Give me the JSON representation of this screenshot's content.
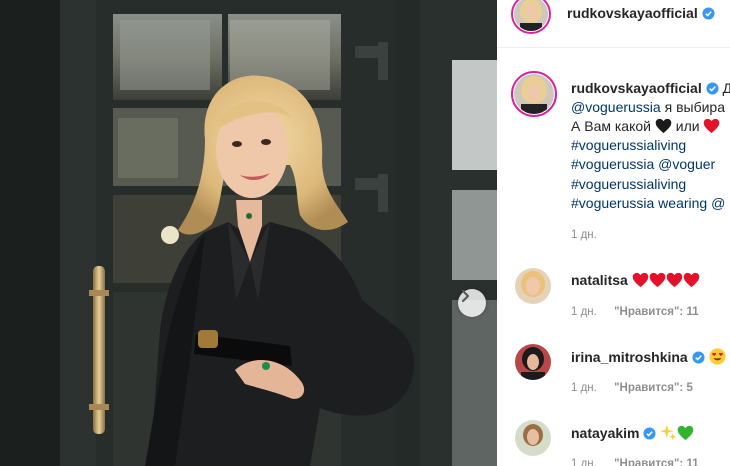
{
  "post": {
    "author": "rudkovskayaofficial",
    "caption_tail": "Д",
    "caption_lines": [
      {
        "text": "@voguerussia",
        "suffix": " я выбира"
      },
      {
        "text": "А Вам какой",
        "suffix": " или "
      },
      {
        "text": "#voguerussialiving",
        "suffix": ""
      },
      {
        "text": "#voguerussia @voguer",
        "suffix": ""
      },
      {
        "text": "#voguerussialiving",
        "suffix": ""
      },
      {
        "text": "#voguerussia",
        "suffix": " wearing @"
      }
    ],
    "time": "1 дн."
  },
  "comments": [
    {
      "user": "natalitsa",
      "verified": false,
      "emojis": [
        "red-heart",
        "red-heart",
        "red-heart",
        "red-heart"
      ],
      "time": "1 дн.",
      "likes": "\"Нравится\": 11"
    },
    {
      "user": "irina_mitroshkina",
      "verified": true,
      "emojis": [
        "heart-eyes"
      ],
      "time": "1 дн.",
      "likes": "\"Нравится\": 5"
    },
    {
      "user": "natayakim",
      "verified": true,
      "emojis": [
        "sparkles",
        "green-heart"
      ],
      "time": "1 дн.",
      "likes": "\"Нравится\": 11"
    }
  ],
  "icons": {
    "next": "chevron-right-icon",
    "verified": "verified-badge-icon"
  },
  "colors": {
    "link": "#00376b",
    "verified": "#3897f0",
    "muted": "#8e8e8e",
    "heart": "#e3122a"
  }
}
